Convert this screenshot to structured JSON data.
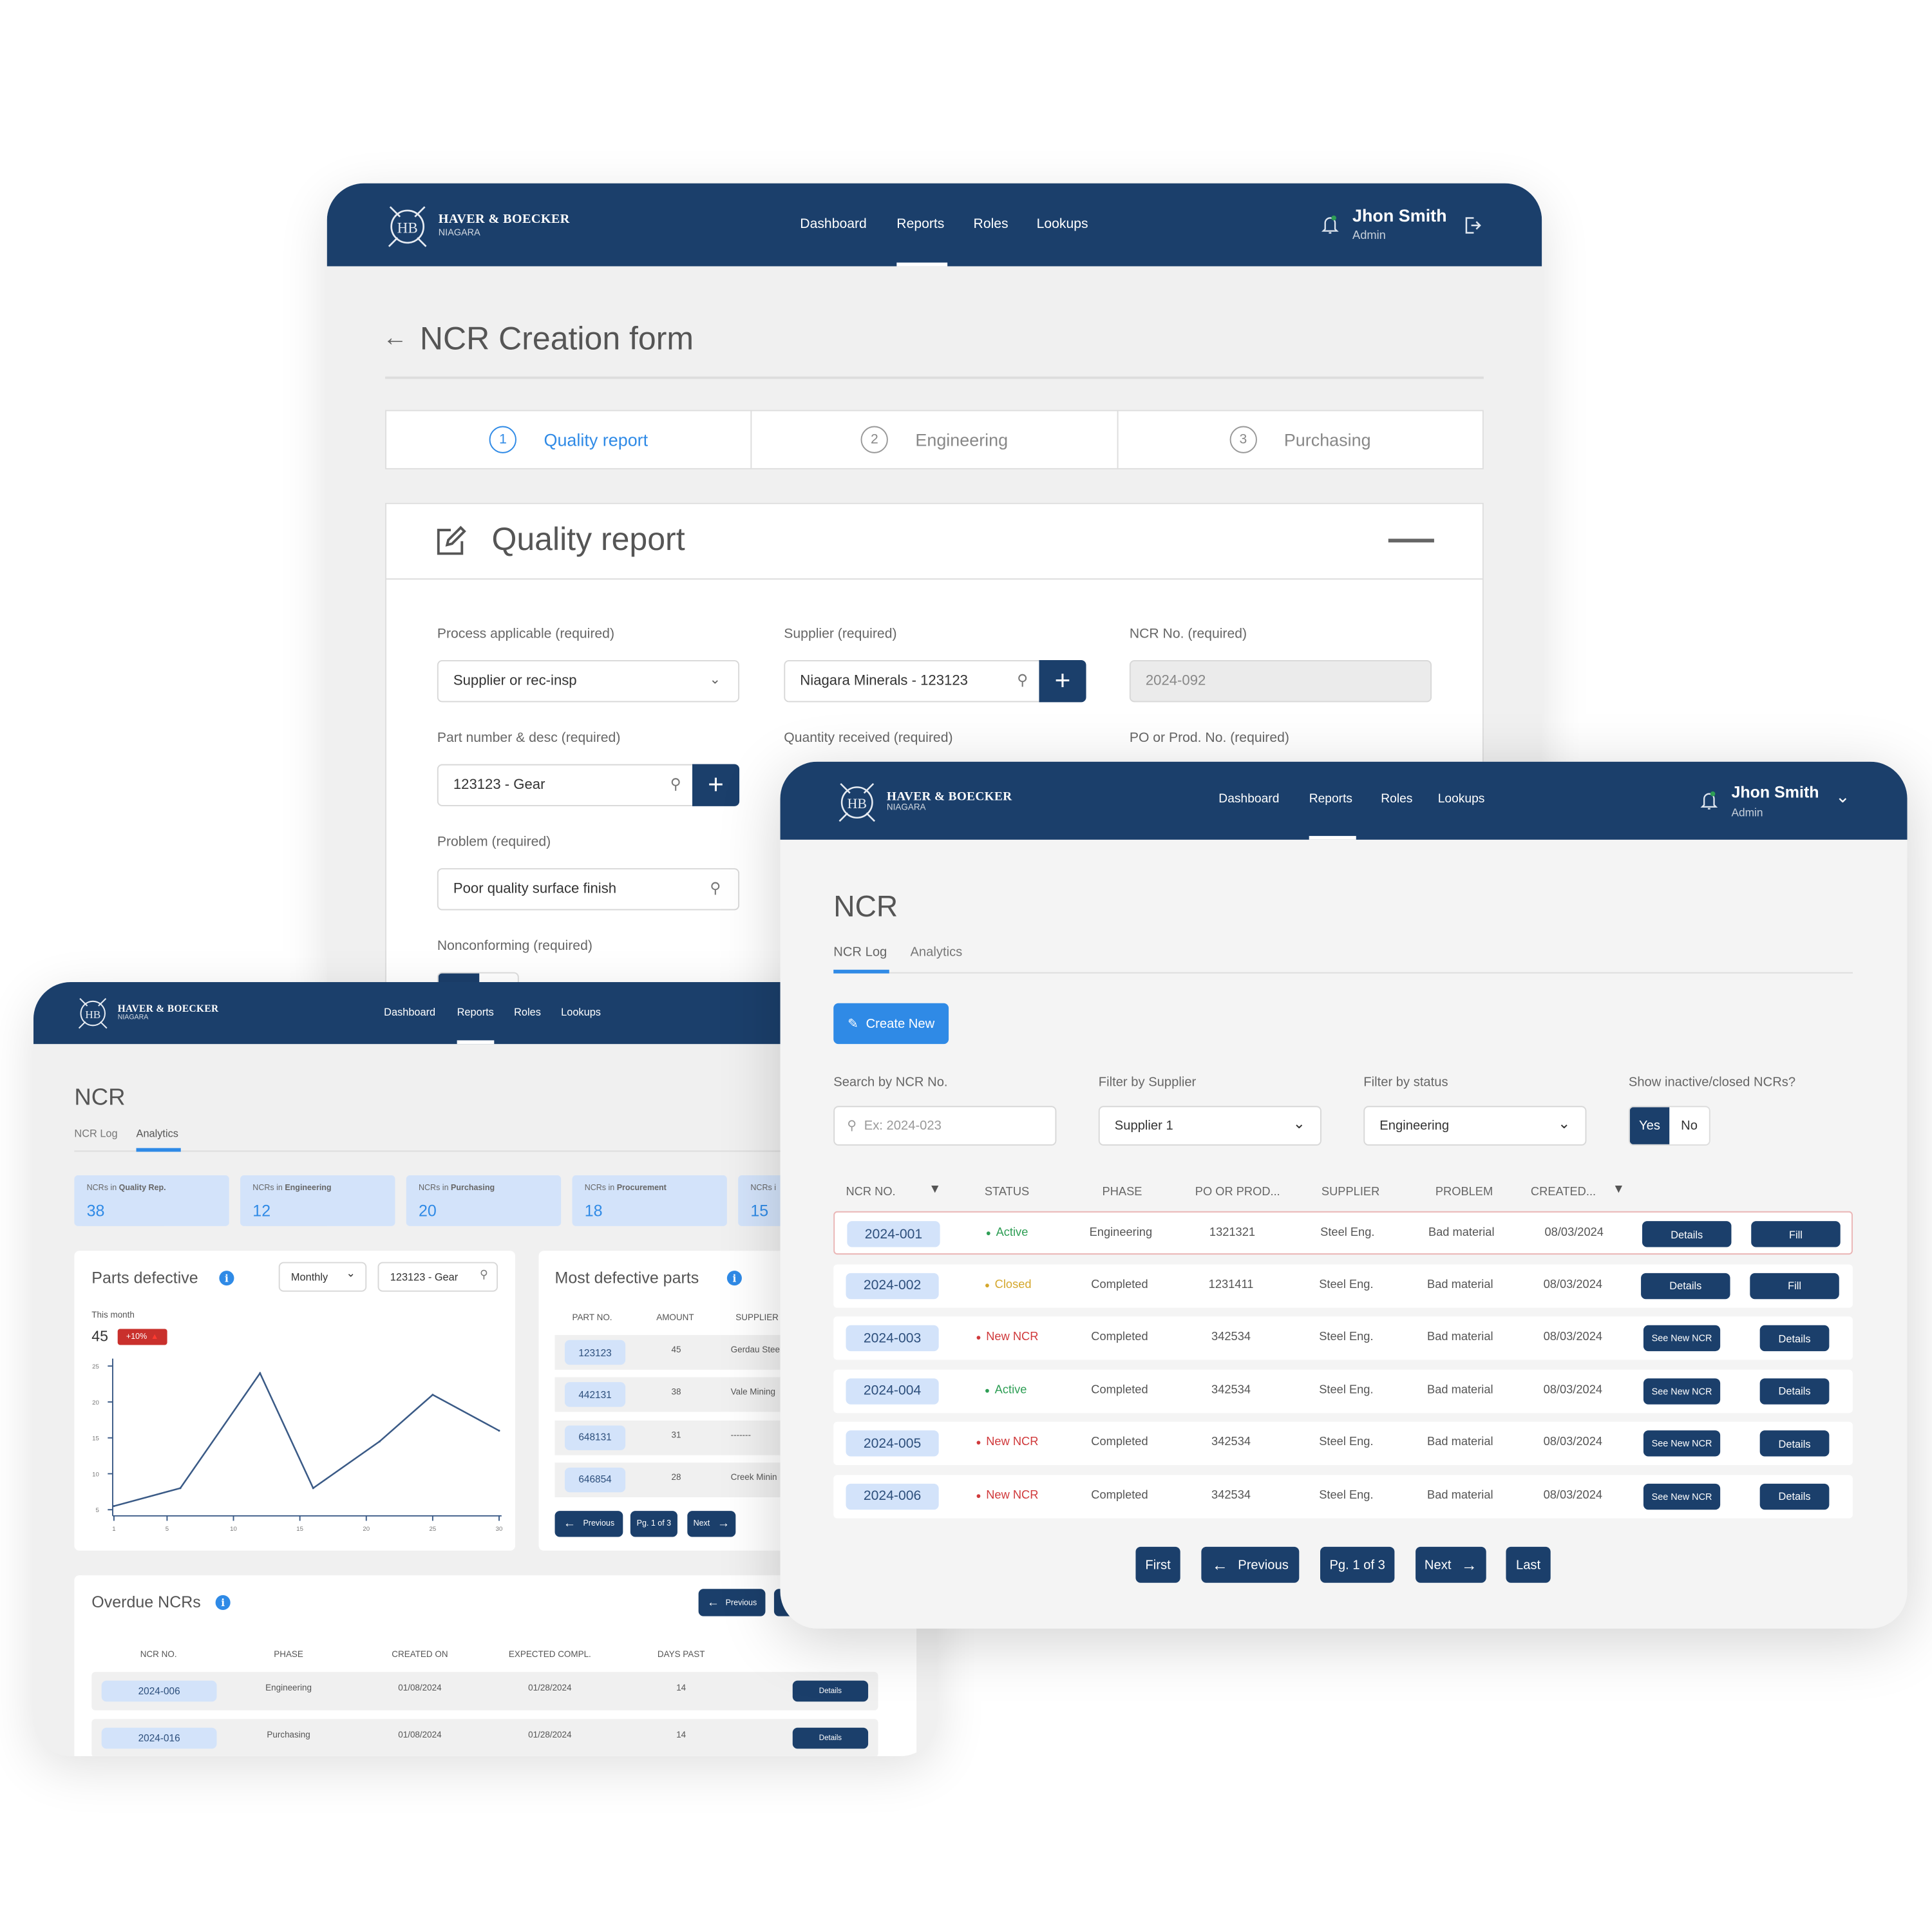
{
  "brand": {
    "name": "HAVER & BOECKER",
    "sub": "NIAGARA"
  },
  "nav": [
    "Dashboard",
    "Reports",
    "Roles",
    "Lookups"
  ],
  "active_nav": "Reports",
  "user": {
    "name": "Jhon Smith",
    "role": "Admin"
  },
  "colors": {
    "navy": "#1b3f6b",
    "accent": "#2f8ae6",
    "badge": "#d3e3fa",
    "active": "#2e9e55",
    "closed": "#d4a72c",
    "new": "#d0393b"
  },
  "form": {
    "title": "NCR Creation form",
    "steps": [
      {
        "num": "1",
        "label": "Quality report",
        "active": true
      },
      {
        "num": "2",
        "label": "Engineering"
      },
      {
        "num": "3",
        "label": "Purchasing"
      }
    ],
    "card_title": "Quality report",
    "fields": {
      "process": {
        "label": "Process applicable (required)",
        "value": "Supplier or rec-insp"
      },
      "supplier": {
        "label": "Supplier (required)",
        "value": "Niagara Minerals - 123123"
      },
      "ncr_no": {
        "label": "NCR No. (required)",
        "value": "2024-092"
      },
      "part": {
        "label": "Part number & desc (required)",
        "value": "123123 - Gear"
      },
      "quantity": {
        "label": "Quantity received (required)"
      },
      "po": {
        "label": "PO or Prod. No. (required)"
      },
      "problem": {
        "label": "Problem (required)",
        "value": "Poor quality surface finish"
      },
      "nonconforming": {
        "label": "Nonconforming (required)"
      }
    }
  },
  "log": {
    "title": "NCR",
    "tabs": [
      "NCR Log",
      "Analytics"
    ],
    "create_label": "Create New",
    "filters": {
      "search": {
        "label": "Search by NCR No.",
        "placeholder": "Ex: 2024-023"
      },
      "supplier": {
        "label": "Filter by Supplier",
        "value": "Supplier 1"
      },
      "status": {
        "label": "Filter by status",
        "value": "Engineering"
      },
      "inactive": {
        "label": "Show inactive/closed NCRs?",
        "yes": "Yes",
        "no": "No",
        "selected": "Yes"
      }
    },
    "columns": [
      "NCR NO.",
      "STATUS",
      "PHASE",
      "PO OR PROD...",
      "SUPPLIER",
      "PROBLEM",
      "CREATED..."
    ],
    "rows": [
      {
        "ncr": "2024-001",
        "status": "Active",
        "phase": "Engineering",
        "po": "1321321",
        "supplier": "Steel Eng.",
        "problem": "Bad material",
        "created": "08/03/2024",
        "a1": "Details",
        "a2": "Fill",
        "highlight": true
      },
      {
        "ncr": "2024-002",
        "status": "Closed",
        "phase": "Completed",
        "po": "1231411",
        "supplier": "Steel Eng.",
        "problem": "Bad material",
        "created": "08/03/2024",
        "a1": "Details",
        "a2": "Fill"
      },
      {
        "ncr": "2024-003",
        "status": "New NCR",
        "phase": "Completed",
        "po": "342534",
        "supplier": "Steel Eng.",
        "problem": "Bad material",
        "created": "08/03/2024",
        "a1": "See New NCR",
        "a2": "Details"
      },
      {
        "ncr": "2024-004",
        "status": "Active",
        "phase": "Completed",
        "po": "342534",
        "supplier": "Steel Eng.",
        "problem": "Bad material",
        "created": "08/03/2024",
        "a1": "See New NCR",
        "a2": "Details"
      },
      {
        "ncr": "2024-005",
        "status": "New NCR",
        "phase": "Completed",
        "po": "342534",
        "supplier": "Steel Eng.",
        "problem": "Bad material",
        "created": "08/03/2024",
        "a1": "See New NCR",
        "a2": "Details"
      },
      {
        "ncr": "2024-006",
        "status": "New NCR",
        "phase": "Completed",
        "po": "342534",
        "supplier": "Steel Eng.",
        "problem": "Bad material",
        "created": "08/03/2024",
        "a1": "See New NCR",
        "a2": "Details"
      }
    ],
    "pagination": {
      "first": "First",
      "previous": "Previous",
      "page": "Pg. 1 of 3",
      "next": "Next",
      "last": "Last"
    }
  },
  "analytics": {
    "title": "NCR",
    "tabs": [
      "NCR Log",
      "Analytics"
    ],
    "stats": [
      {
        "prefix": "NCRs in",
        "bold": "Quality Rep.",
        "value": "38"
      },
      {
        "prefix": "NCRs in",
        "bold": "Engineering",
        "value": "12"
      },
      {
        "prefix": "NCRs in",
        "bold": "Purchasing",
        "value": "20"
      },
      {
        "prefix": "NCRs in",
        "bold": "Procurement",
        "value": "18"
      },
      {
        "prefix": "NCRs i",
        "bold": "",
        "value": "15"
      }
    ],
    "parts_defective": {
      "title": "Parts defective",
      "period": "Monthly",
      "part": "123123 - Gear",
      "this_month_label": "This month",
      "this_month_value": "45",
      "change": "+10%"
    },
    "most_defective": {
      "title": "Most defective parts",
      "columns": [
        "PART NO.",
        "AMOUNT",
        "SUPPLIER"
      ],
      "rows": [
        {
          "part": "123123",
          "amount": "45",
          "supplier": "Gerdau Stee"
        },
        {
          "part": "442131",
          "amount": "38",
          "supplier": "Vale Mining"
        },
        {
          "part": "648131",
          "amount": "31",
          "supplier": "-------"
        },
        {
          "part": "646854",
          "amount": "28",
          "supplier": "Creek Minin"
        }
      ],
      "pagination": {
        "previous": "Previous",
        "page": "Pg. 1 of 3",
        "next": "Next"
      }
    },
    "overdue": {
      "title": "Overdue NCRs",
      "previous": "Previous",
      "columns": [
        "NCR NO.",
        "PHASE",
        "CREATED ON",
        "EXPECTED COMPL.",
        "DAYS PAST"
      ],
      "rows": [
        {
          "ncr": "2024-006",
          "phase": "Engineering",
          "created": "01/08/2024",
          "expected": "01/28/2024",
          "days": "14",
          "action": "Details"
        },
        {
          "ncr": "2024-016",
          "phase": "Purchasing",
          "created": "01/08/2024",
          "expected": "01/28/2024",
          "days": "14",
          "action": "Details"
        }
      ]
    }
  },
  "chart_data": {
    "type": "line",
    "title": "Parts defective",
    "x": [
      1,
      6,
      12,
      16,
      21,
      25,
      30
    ],
    "y": [
      5.5,
      8,
      24,
      8,
      14.5,
      21,
      16
    ],
    "xticks": [
      1,
      5,
      10,
      15,
      20,
      25,
      30
    ],
    "yticks": [
      5,
      10,
      15,
      20,
      25
    ],
    "xlim": [
      1,
      30
    ],
    "ylim": [
      5,
      25
    ],
    "grid": false,
    "color": "#3a5a86"
  }
}
